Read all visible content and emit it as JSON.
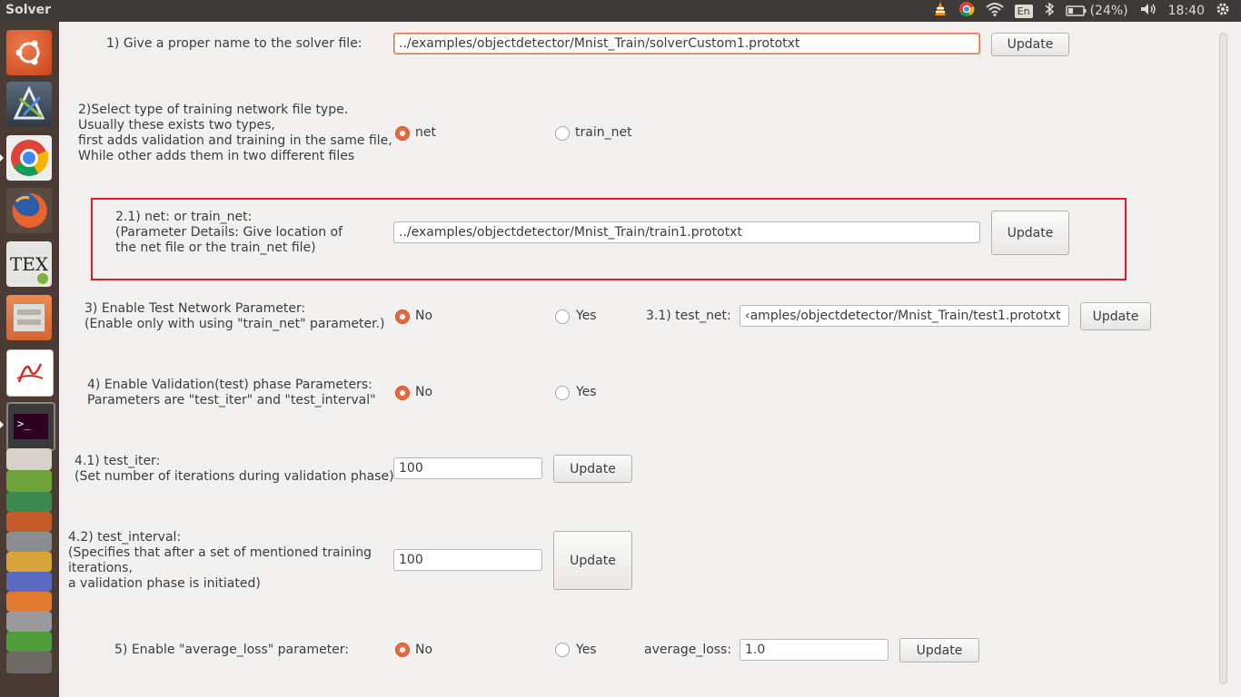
{
  "window": {
    "title": "Solver"
  },
  "tray": {
    "keyboard": "En",
    "battery": "(24%)",
    "clock": "18:40"
  },
  "launcher": {
    "apps": [
      "ubuntu-dash-icon",
      "inkscape-icon",
      "chrome-icon",
      "firefox-icon",
      "texmaker-icon",
      "files-icon",
      "document-viewer-icon",
      "terminal-icon",
      "writer-icon",
      "vlc-icon",
      "calc-icon",
      "app-stack-icon",
      "draw-icon",
      "impress-icon",
      "installer-icon",
      "software-center-icon",
      "settings-icon",
      "trash-icon"
    ],
    "tex_label": "TEX"
  },
  "form": {
    "q1": {
      "label": "1) Give a proper name to the solver file:",
      "value": "../examples/objectdetector/Mnist_Train/solverCustom1.prototxt",
      "button": "Update"
    },
    "q2": {
      "label": "2)Select type of training network file type.\nUsually these exists two types,\nfirst adds validation and training in the same file,\nWhile other adds them in two different files",
      "opt1": "net",
      "opt2": "train_net"
    },
    "q21": {
      "label": "2.1) net: or train_net:\n(Parameter Details: Give location of\nthe net file or the train_net file)",
      "value": "../examples/objectdetector/Mnist_Train/train1.prototxt",
      "button": "Update"
    },
    "q3": {
      "label": "3) Enable Test Network Parameter:\n(Enable only with using \"train_net\" parameter.)",
      "opt1": "No",
      "opt2": "Yes",
      "sub_label": "3.1) test_net:",
      "value": "‹amples/objectdetector/Mnist_Train/test1.prototxt",
      "button": "Update"
    },
    "q4": {
      "label": "4) Enable Validation(test) phase Parameters:\nParameters are \"test_iter\" and \"test_interval\"",
      "opt1": "No",
      "opt2": "Yes"
    },
    "q41": {
      "label": "4.1) test_iter:\n(Set number of iterations during validation phase)",
      "value": "100",
      "button": "Update"
    },
    "q42": {
      "label": "4.2) test_interval:\n(Specifies that after a set of mentioned training\niterations,\na validation phase is initiated)",
      "value": "100",
      "button": "Update"
    },
    "q5": {
      "label": "5) Enable \"average_loss\" parameter:",
      "opt1": "No",
      "opt2": "Yes",
      "sub_label": "average_loss:",
      "value": "1.0",
      "button": "Update"
    }
  }
}
